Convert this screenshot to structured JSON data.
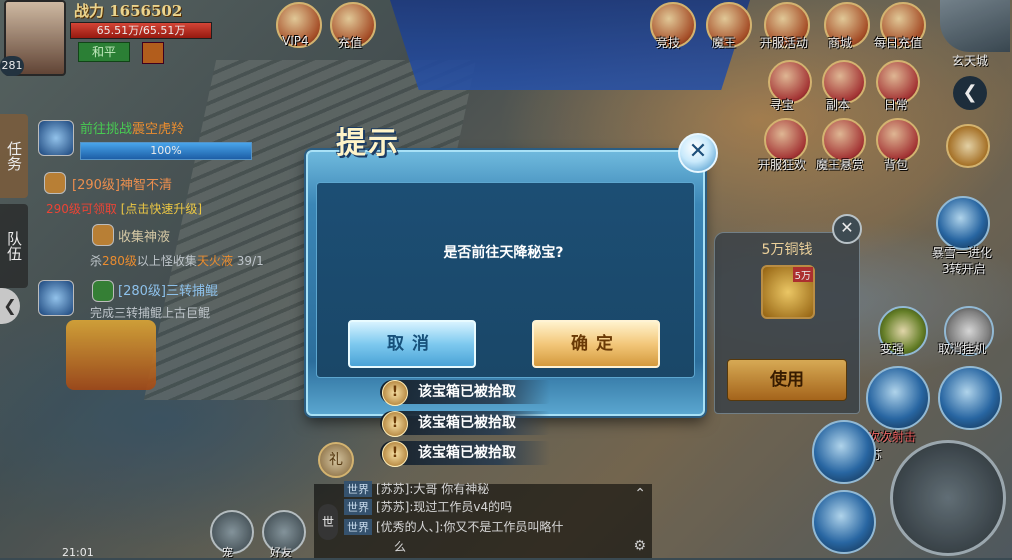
{
  "player": {
    "level": "281",
    "power": "战力 1656502",
    "hp_text": "65.51万/65.51万",
    "hp_fraction": 1.0,
    "mode_label": "和平"
  },
  "top_icons": [
    {
      "label": "VIP4",
      "icon": "vip-icon"
    },
    {
      "label": "充值",
      "icon": "recharge-icon"
    },
    {
      "label": "竞技",
      "icon": "arena-icon"
    },
    {
      "label": "魔王",
      "icon": "demon-king-icon"
    },
    {
      "label": "开服活动",
      "icon": "server-event-icon"
    },
    {
      "label": "商城",
      "icon": "shop-icon"
    },
    {
      "label": "每日充值",
      "icon": "daily-recharge-icon"
    }
  ],
  "second_row_icons": [
    {
      "label": "寻宝",
      "icon": "treasure-hunt-icon"
    },
    {
      "label": "副本",
      "icon": "dungeon-icon"
    },
    {
      "label": "日常",
      "icon": "daily-icon"
    }
  ],
  "third_row_icons": [
    {
      "label": "开服狂欢",
      "icon": "carnival-icon"
    },
    {
      "label": "魔王悬赏",
      "icon": "bounty-icon"
    },
    {
      "label": "背包",
      "icon": "bag-icon"
    }
  ],
  "map": {
    "name": "玄天城",
    "back_symbol": "❮"
  },
  "side_tabs": [
    {
      "label": "任务"
    },
    {
      "label": "队伍"
    }
  ],
  "quests": [
    {
      "title_a": "前往挑战",
      "title_b": "震空虎羚",
      "progress_text": "100%",
      "progress_fraction": 1.0
    },
    {
      "title": "[290级]神智不清",
      "detail_a": "290级可领取",
      "detail_b": "[点击快速升级]"
    },
    {
      "title": "收集神液",
      "detail_a": "杀",
      "detail_b": "280级",
      "detail_c": "以上怪收集",
      "detail_d": "天火液",
      "detail_e": "39/1"
    },
    {
      "title": "[280级]三转捕鲲",
      "detail_a": "完成三转捕鲲上古巨鲲"
    }
  ],
  "quest_badges": [
    "主",
    "支",
    "支"
  ],
  "item_panel": {
    "name": "5万铜钱",
    "badge": "5万",
    "use_label": "使用",
    "close_symbol": "✕"
  },
  "dialog": {
    "title": "提示",
    "message": "是否前往天降秘宝?",
    "cancel_label": "取消",
    "confirm_label": "确定",
    "close_symbol": "✕"
  },
  "toasts": [
    {
      "text": "该宝箱已被拾取",
      "icon_symbol": "!"
    },
    {
      "text": "该宝箱已被拾取",
      "icon_symbol": "!"
    },
    {
      "text": "该宝箱已被拾取",
      "icon_symbol": "!"
    }
  ],
  "skills": {
    "awaken_label": "暴雪一进化",
    "awaken_sub": "3转开启",
    "transform_label": "变强",
    "cancel_auto_label": "取消挂机",
    "skill_hint": "次次射击",
    "skill_hint2": "苏"
  },
  "chat": {
    "lines": [
      {
        "channel": "世界",
        "text": "[苏苏]:大哥 你有神秘"
      },
      {
        "channel": "世界",
        "text": "[苏苏]:现过工作员v4的吗"
      },
      {
        "channel": "世界",
        "text": "[优秀的人、]:你又不是工作员叫略什"
      }
    ],
    "overflow_line": "么",
    "mic_label": "世",
    "scroll_symbol": "⌃",
    "settings_symbol": "⚙"
  },
  "bottom": {
    "clock": "21:01",
    "gift_label": "礼",
    "icons": [
      {
        "label": "宠"
      },
      {
        "label": "好友"
      }
    ]
  }
}
